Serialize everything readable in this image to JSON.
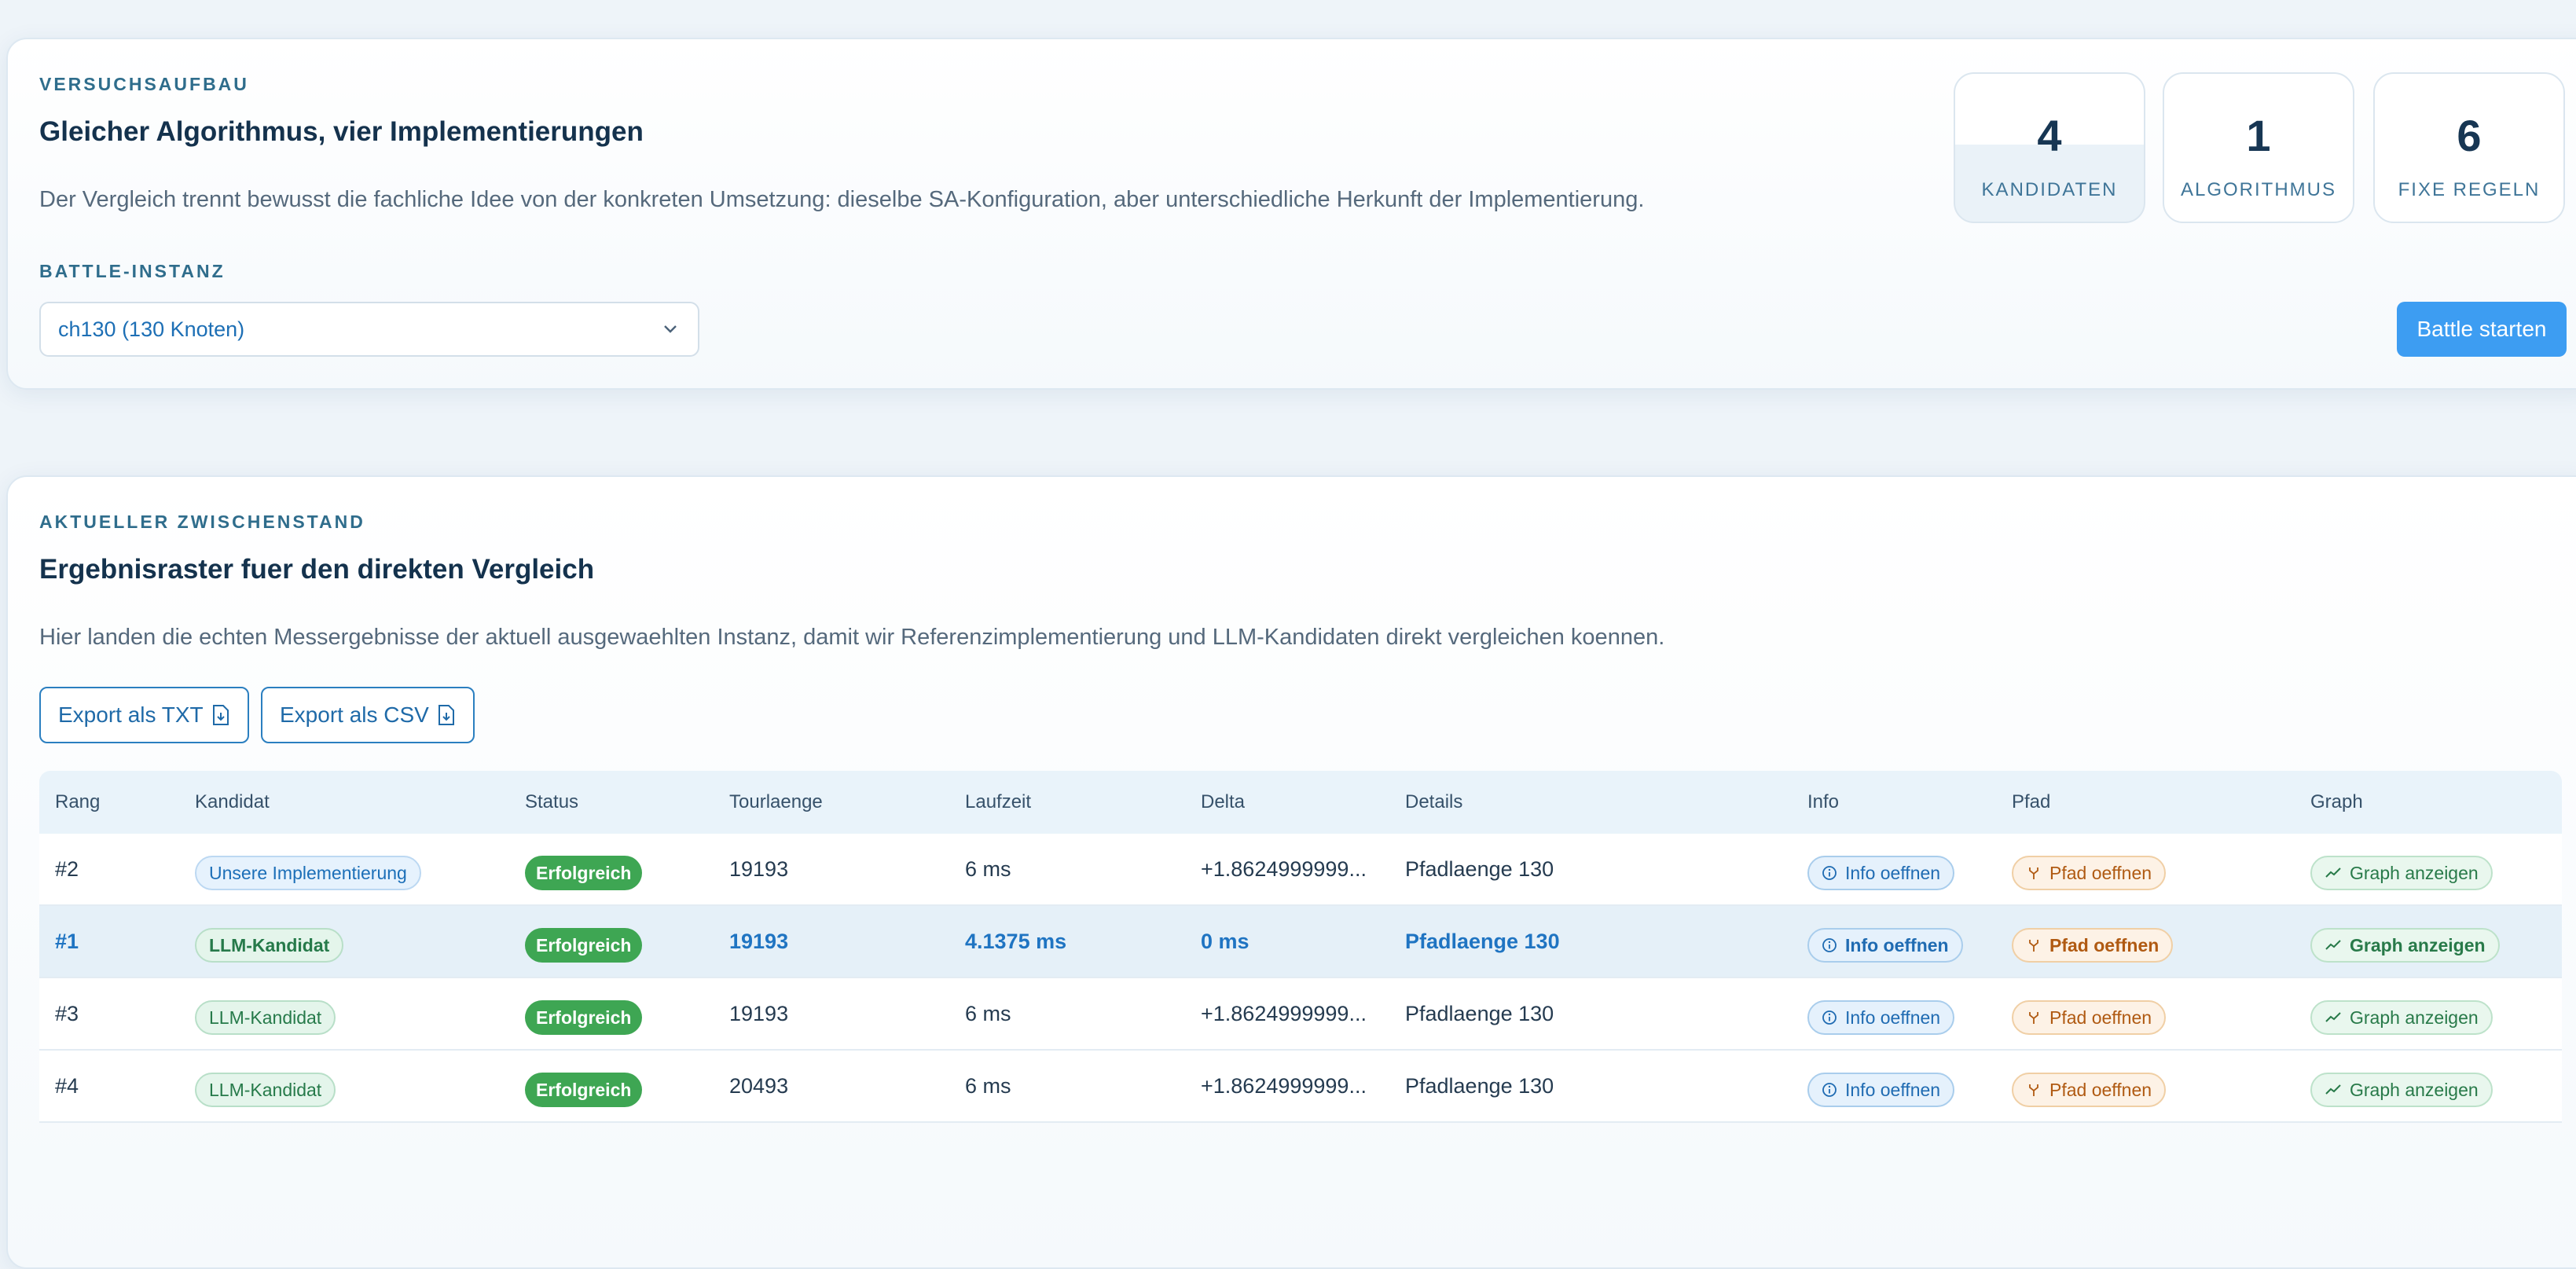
{
  "setup": {
    "eyebrow": "VERSUCHSAUFBAU",
    "title": "Gleicher Algorithmus, vier Implementierungen",
    "description": "Der Vergleich trennt bewusst die fachliche Idee von der konkreten Umsetzung: dieselbe SA-Konfiguration, aber unterschiedliche Herkunft der Implementierung.",
    "instance_label": "BATTLE-INSTANZ",
    "instance_value": "ch130 (130 Knoten)",
    "start_button": "Battle starten",
    "stats": [
      {
        "value": "4",
        "label": "KANDIDATEN"
      },
      {
        "value": "1",
        "label": "ALGORITHMUS"
      },
      {
        "value": "6",
        "label": "FIXE REGELN"
      }
    ]
  },
  "results": {
    "eyebrow": "AKTUELLER ZWISCHENSTAND",
    "title": "Ergebnisraster fuer den direkten Vergleich",
    "description": "Hier landen die echten Messergebnisse der aktuell ausgewaehlten Instanz, damit wir Referenzimplementierung und LLM-Kandidaten direkt vergleichen koennen.",
    "export_txt": "Export als TXT",
    "export_csv": "Export als CSV",
    "columns": [
      "Rang",
      "Kandidat",
      "Status",
      "Tourlaenge",
      "Laufzeit",
      "Delta",
      "Details",
      "Info",
      "Pfad",
      "Graph"
    ],
    "rows": [
      {
        "rank": "#2",
        "candidate": "Unsere Implementierung",
        "kind": "impl",
        "status": "Erfolgreich",
        "tour": "19193",
        "runtime": "6 ms",
        "delta": "+1.8624999999...",
        "details": "Pfadlaenge 130",
        "info": "Info oeffnen",
        "path": "Pfad oeffnen",
        "graph": "Graph anzeigen",
        "highlight": false
      },
      {
        "rank": "#1",
        "candidate": "LLM-Kandidat",
        "kind": "llm",
        "status": "Erfolgreich",
        "tour": "19193",
        "runtime": "4.1375 ms",
        "delta": "0 ms",
        "details": "Pfadlaenge 130",
        "info": "Info oeffnen",
        "path": "Pfad oeffnen",
        "graph": "Graph anzeigen",
        "highlight": true
      },
      {
        "rank": "#3",
        "candidate": "LLM-Kandidat",
        "kind": "llm",
        "status": "Erfolgreich",
        "tour": "19193",
        "runtime": "6 ms",
        "delta": "+1.8624999999...",
        "details": "Pfadlaenge 130",
        "info": "Info oeffnen",
        "path": "Pfad oeffnen",
        "graph": "Graph anzeigen",
        "highlight": false
      },
      {
        "rank": "#4",
        "candidate": "LLM-Kandidat",
        "kind": "llm",
        "status": "Erfolgreich",
        "tour": "20493",
        "runtime": "6 ms",
        "delta": "+1.8624999999...",
        "details": "Pfadlaenge 130",
        "info": "Info oeffnen",
        "path": "Pfad oeffnen",
        "graph": "Graph anzeigen",
        "highlight": false
      }
    ]
  },
  "colors": {
    "primary": "#3d9df2",
    "success": "#3ea653",
    "highlight_row": "#e5f0f8"
  }
}
